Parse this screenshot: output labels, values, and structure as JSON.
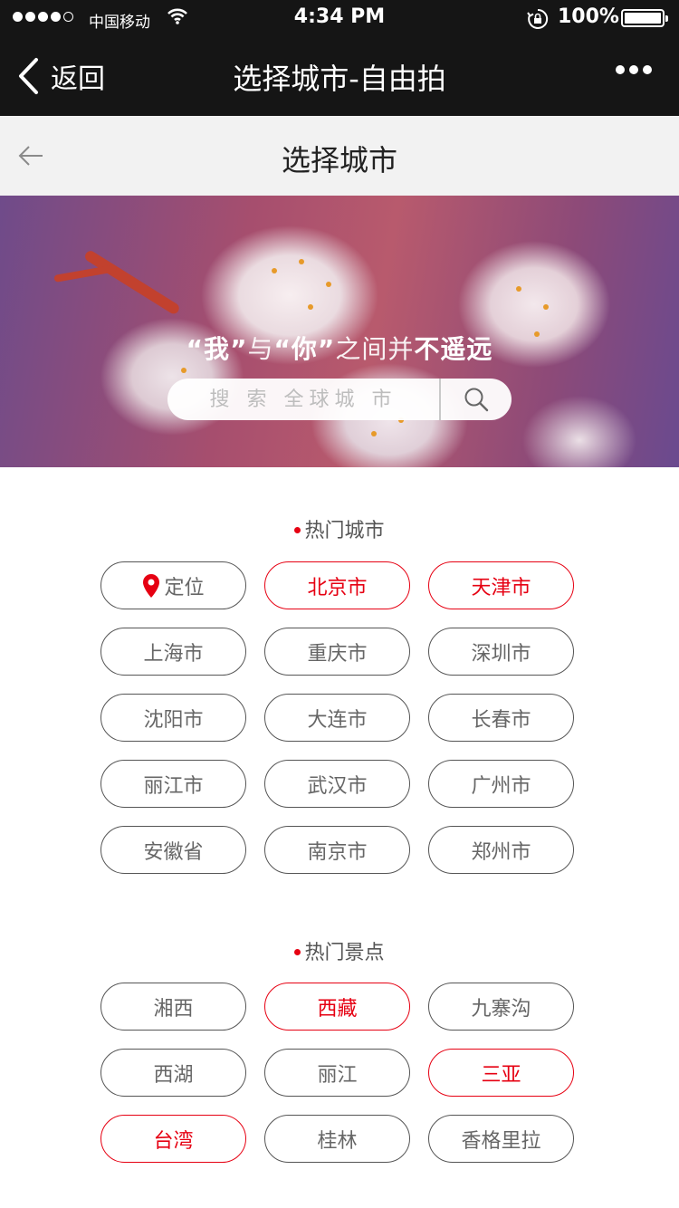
{
  "status_bar": {
    "carrier": "中国移动",
    "time": "4:34 PM",
    "battery": "100%"
  },
  "nav": {
    "back_label": "返回",
    "title": "选择城市-自由拍"
  },
  "sub_header": {
    "title": "选择城市"
  },
  "banner": {
    "slogan_q1": "“",
    "slogan_me": "我",
    "slogan_q2": "”",
    "slogan_with": "与",
    "slogan_q3": "“",
    "slogan_you": "你",
    "slogan_q4": "”",
    "slogan_between": "之间并",
    "slogan_not_far": "不遥远",
    "search_placeholder": "搜 索 全球城 市"
  },
  "hot_cities": {
    "title": "热门城市",
    "items": [
      {
        "label": "定位",
        "highlight": false,
        "icon": "location-pin-icon"
      },
      {
        "label": "北京市",
        "highlight": true
      },
      {
        "label": "天津市",
        "highlight": true
      },
      {
        "label": "上海市",
        "highlight": false
      },
      {
        "label": "重庆市",
        "highlight": false
      },
      {
        "label": "深圳市",
        "highlight": false
      },
      {
        "label": "沈阳市",
        "highlight": false
      },
      {
        "label": "大连市",
        "highlight": false
      },
      {
        "label": "长春市",
        "highlight": false
      },
      {
        "label": "丽江市",
        "highlight": false
      },
      {
        "label": "武汉市",
        "highlight": false
      },
      {
        "label": "广州市",
        "highlight": false
      },
      {
        "label": "安徽省",
        "highlight": false
      },
      {
        "label": "南京市",
        "highlight": false
      },
      {
        "label": "郑州市",
        "highlight": false
      }
    ]
  },
  "hot_spots": {
    "title": "热门景点",
    "items": [
      {
        "label": "湘西",
        "highlight": false
      },
      {
        "label": "西藏",
        "highlight": true
      },
      {
        "label": "九寨沟",
        "highlight": false
      },
      {
        "label": "西湖",
        "highlight": false
      },
      {
        "label": "丽江",
        "highlight": false
      },
      {
        "label": "三亚",
        "highlight": true
      },
      {
        "label": "台湾",
        "highlight": true
      },
      {
        "label": "桂林",
        "highlight": false
      },
      {
        "label": "香格里拉",
        "highlight": false
      }
    ]
  },
  "colors": {
    "accent_red": "#e60012",
    "nav_black": "#151515",
    "subheader_gray": "#f2f2f2"
  }
}
